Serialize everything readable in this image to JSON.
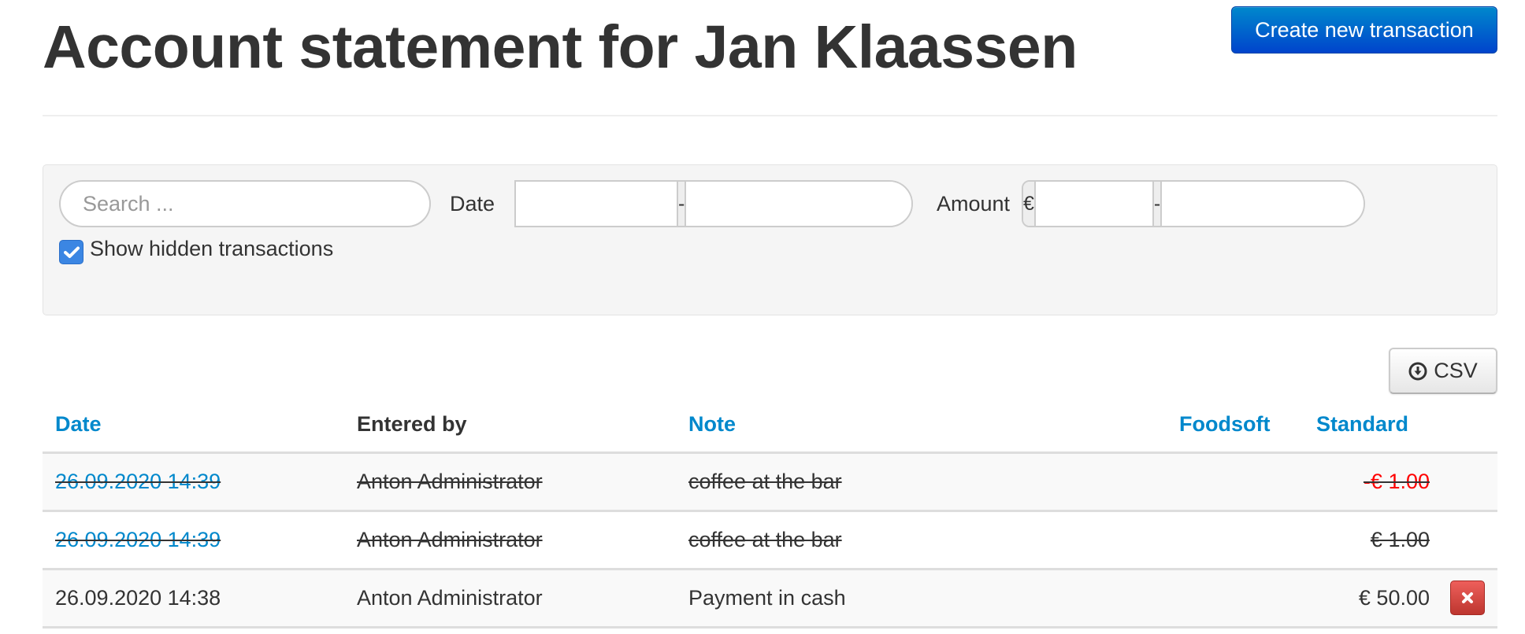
{
  "header": {
    "title": "Account statement for Jan Klaassen",
    "create_button": "Create new transaction"
  },
  "filters": {
    "search_placeholder": "Search ...",
    "search_value": "",
    "date_label": "Date",
    "date_from": "",
    "date_separator": "-",
    "date_to": "",
    "amount_label": "Amount",
    "currency_symbol": "€",
    "amount_from": "",
    "amount_separator": "-",
    "amount_to": "",
    "show_hidden_label": "Show hidden transactions",
    "show_hidden_checked": true
  },
  "export": {
    "csv_label": "CSV",
    "icon": "download-circle-icon"
  },
  "table": {
    "columns": [
      {
        "label": "Date",
        "sortable": true
      },
      {
        "label": "Entered by",
        "sortable": false
      },
      {
        "label": "Note",
        "sortable": true
      },
      {
        "label": "Foodsoft",
        "sortable": true
      },
      {
        "label": "Standard",
        "sortable": true
      }
    ],
    "rows": [
      {
        "date": "26.09.2020 14:39",
        "entered_by": "Anton Administrator",
        "note": "coffee at the bar",
        "foodsoft": "",
        "standard": "-€ 1.00",
        "hidden": true,
        "negative": true,
        "deletable": false
      },
      {
        "date": "26.09.2020 14:39",
        "entered_by": "Anton Administrator",
        "note": "coffee at the bar",
        "foodsoft": "",
        "standard": "€ 1.00",
        "hidden": true,
        "negative": false,
        "deletable": false
      },
      {
        "date": "26.09.2020 14:38",
        "entered_by": "Anton Administrator",
        "note": "Payment in cash",
        "foodsoft": "",
        "standard": "€ 50.00",
        "hidden": false,
        "negative": false,
        "deletable": true
      }
    ]
  },
  "colors": {
    "primary": "#0066cc",
    "link": "#0088cc",
    "negative": "#ff0000",
    "danger": "#bd362f",
    "checkbox": "#3b86e3"
  }
}
